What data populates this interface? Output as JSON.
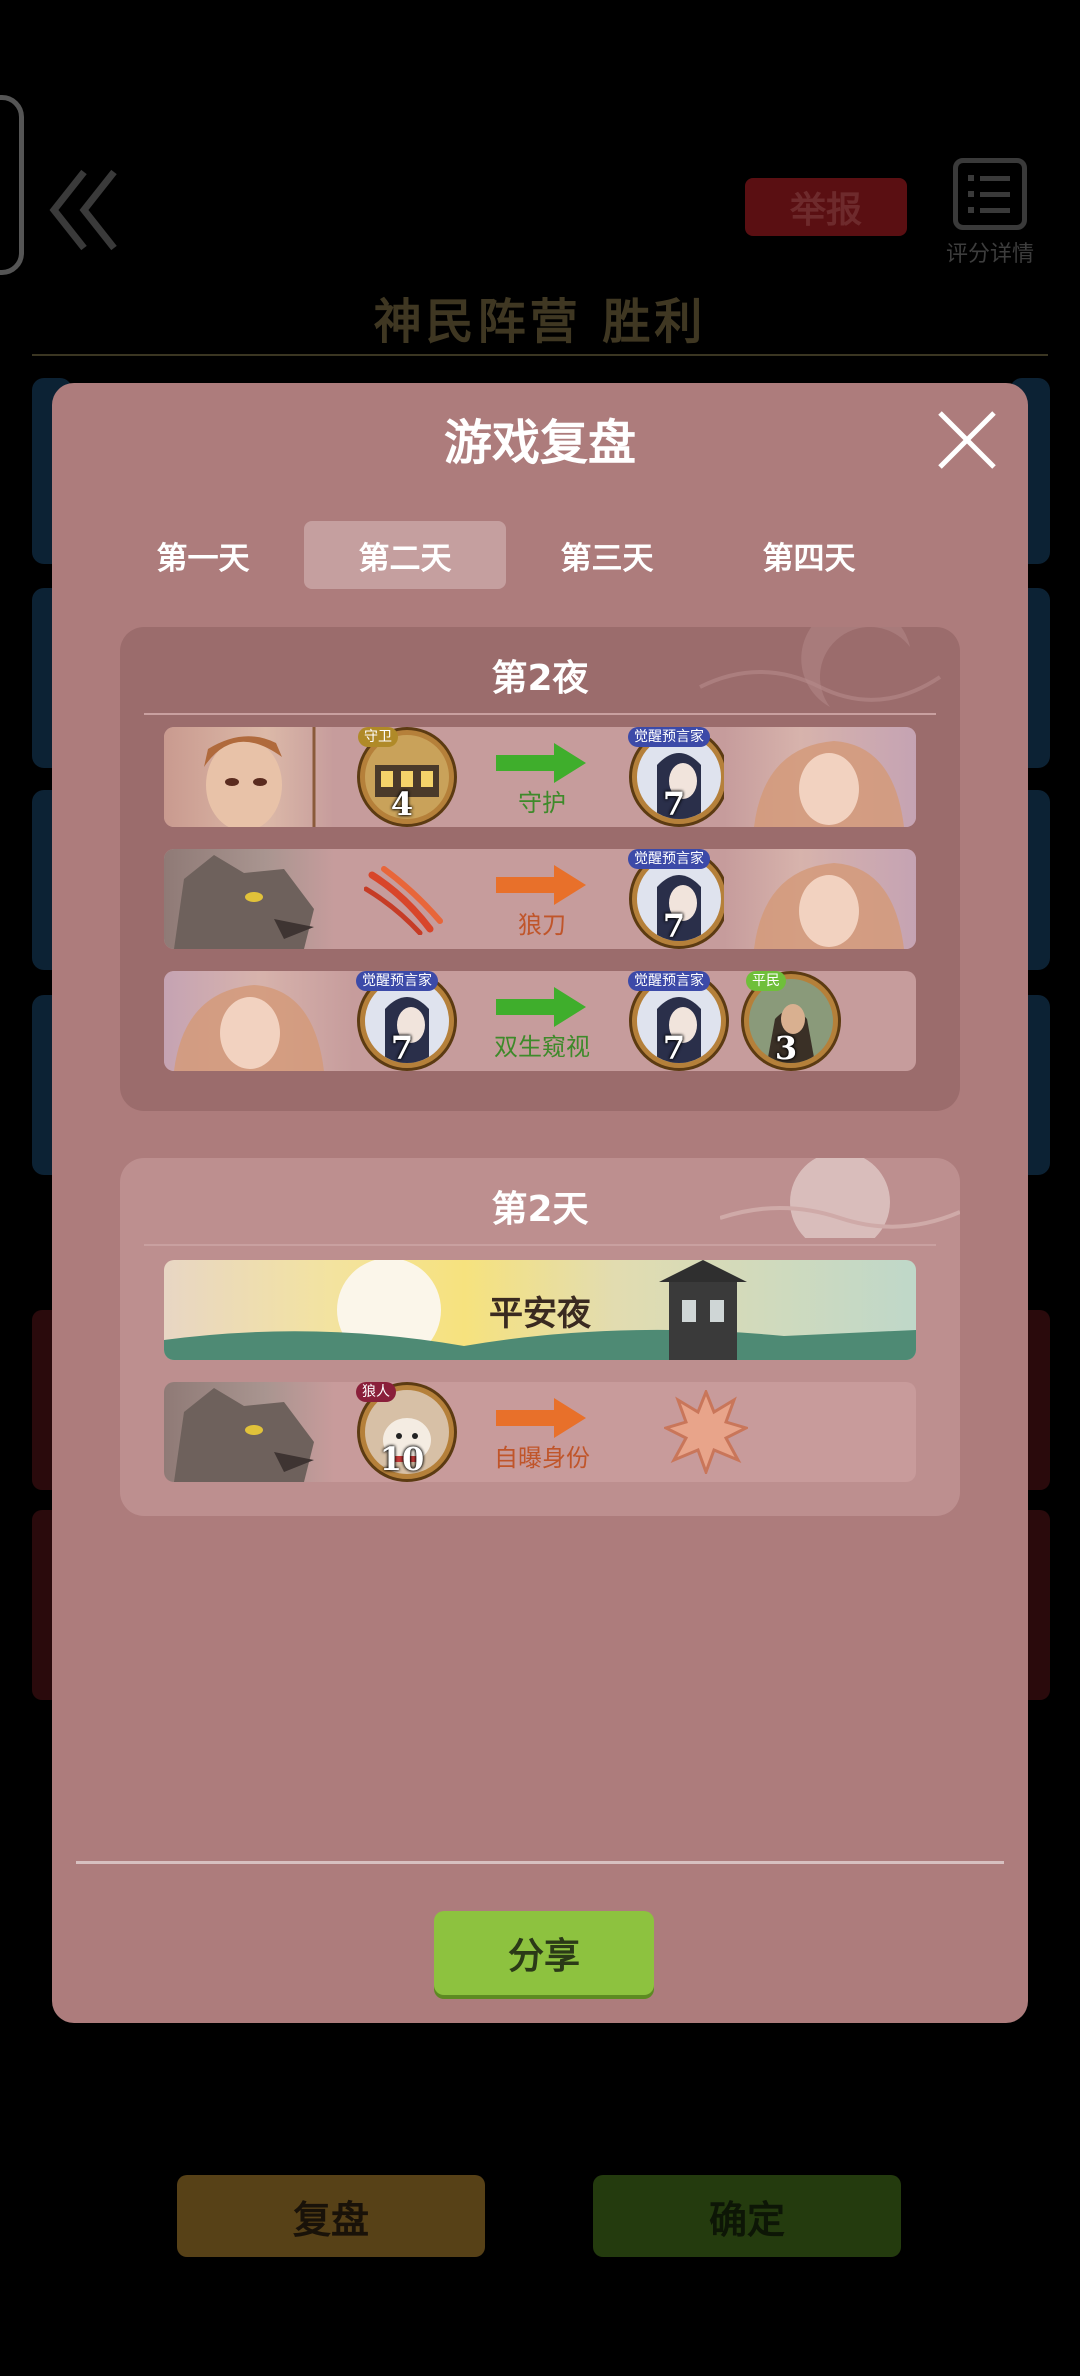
{
  "header": {
    "report_label": "举报",
    "score_detail_label": "评分详情",
    "result_title": "神民阵营  胜利"
  },
  "modal": {
    "title": "游戏复盘",
    "tabs": [
      {
        "label": "第一天",
        "active": false
      },
      {
        "label": "第二天",
        "active": true
      },
      {
        "label": "第三天",
        "active": false
      },
      {
        "label": "第四天",
        "active": false
      }
    ],
    "night": {
      "title": "第2夜",
      "rows": [
        {
          "actor_badge": "守卫",
          "actor_number": "4",
          "action": "守护",
          "target_badge": "觉醒预言家",
          "target_number": "7"
        },
        {
          "action": "狼刀",
          "target_badge": "觉醒预言家",
          "target_number": "7"
        },
        {
          "actor_badge": "觉醒预言家",
          "actor_number": "7",
          "action": "双生窥视",
          "target_badge": "觉醒预言家",
          "target_number": "7",
          "extra_badge": "平民",
          "extra_number": "3"
        }
      ]
    },
    "day": {
      "title": "第2天",
      "peace_label": "平安夜",
      "event": {
        "actor_badge": "狼人",
        "actor_number": "10",
        "action": "自曝身份"
      }
    },
    "share_label": "分享"
  },
  "footer": {
    "replay_label": "复盘",
    "confirm_label": "确定"
  },
  "colors": {
    "modal_bg": "#ad7c7c",
    "green_action": "#3e8a2a",
    "orange_action": "#c0552a",
    "share_button": "#8dc23f"
  }
}
